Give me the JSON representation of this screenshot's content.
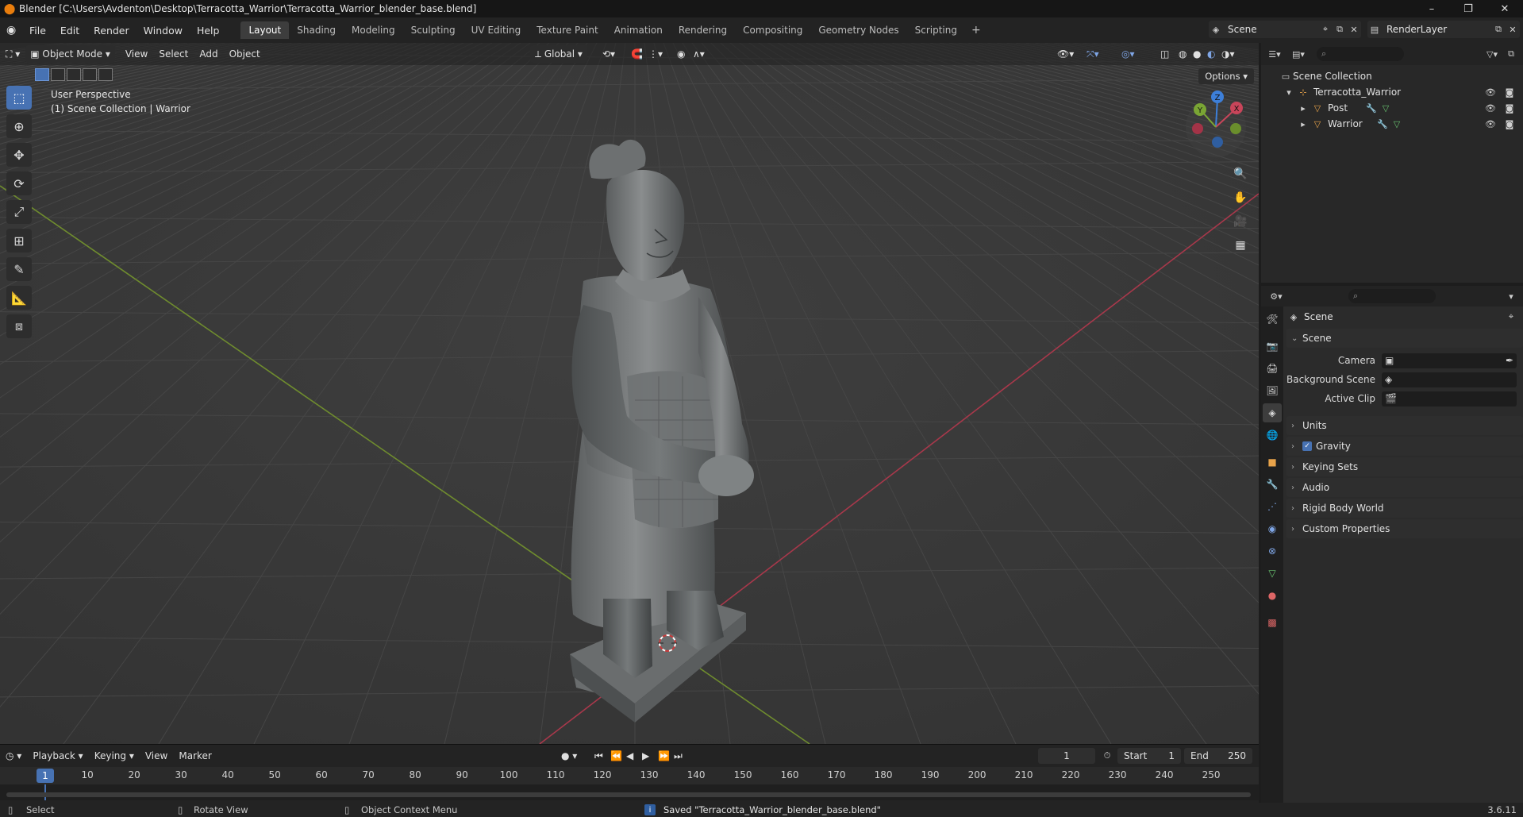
{
  "window": {
    "title": "Blender [C:\\Users\\Avdenton\\Desktop\\Terracotta_Warrior\\Terracotta_Warrior_blender_base.blend]",
    "minimize": "–",
    "maximize": "❐",
    "close": "✕"
  },
  "menu": [
    "File",
    "Edit",
    "Render",
    "Window",
    "Help"
  ],
  "workspaces": [
    "Layout",
    "Shading",
    "Modeling",
    "Sculpting",
    "UV Editing",
    "Texture Paint",
    "Animation",
    "Rendering",
    "Compositing",
    "Geometry Nodes",
    "Scripting"
  ],
  "scene_name": "Scene",
  "render_layer": "RenderLayer",
  "viewport": {
    "mode": "Object Mode",
    "menus": [
      "View",
      "Select",
      "Add",
      "Object"
    ],
    "transform_orientation": "Global",
    "options_label": "Options",
    "info_line1": "User Perspective",
    "info_line2": "(1) Scene Collection | Warrior",
    "gizmo": {
      "z": "Z",
      "y": "Y",
      "x": "X"
    }
  },
  "timeline": {
    "menus": [
      "Playback",
      "Keying",
      "View",
      "Marker"
    ],
    "current_frame": "1",
    "start_label": "Start",
    "start_value": "1",
    "end_label": "End",
    "end_value": "250",
    "ruler": [
      "10",
      "20",
      "30",
      "40",
      "50",
      "60",
      "70",
      "80",
      "90",
      "100",
      "110",
      "120",
      "130",
      "140",
      "150",
      "160",
      "170",
      "180",
      "190",
      "200",
      "210",
      "220",
      "230",
      "240",
      "250"
    ],
    "ruler_current": "1"
  },
  "statusbar": {
    "select": "Select",
    "rotate": "Rotate View",
    "context": "Object Context Menu",
    "message": "Saved \"Terracotta_Warrior_blender_base.blend\"",
    "version": "3.6.11"
  },
  "outliner": {
    "root": "Scene Collection",
    "items": [
      {
        "name": "Terracotta_Warrior",
        "depth": 1
      },
      {
        "name": "Post",
        "depth": 2
      },
      {
        "name": "Warrior",
        "depth": 2
      }
    ]
  },
  "properties": {
    "context_title": "Scene",
    "panel_title": "Scene",
    "fields": {
      "camera": "Camera",
      "background_scene": "Background Scene",
      "active_clip": "Active Clip"
    },
    "panels": [
      "Units",
      "Gravity",
      "Keying Sets",
      "Audio",
      "Rigid Body World",
      "Custom Properties"
    ]
  },
  "colors": {
    "accent": "#4772b3",
    "x_axis": "#c8455a",
    "y_axis": "#7aa534",
    "z_axis": "#3d7fd9"
  }
}
